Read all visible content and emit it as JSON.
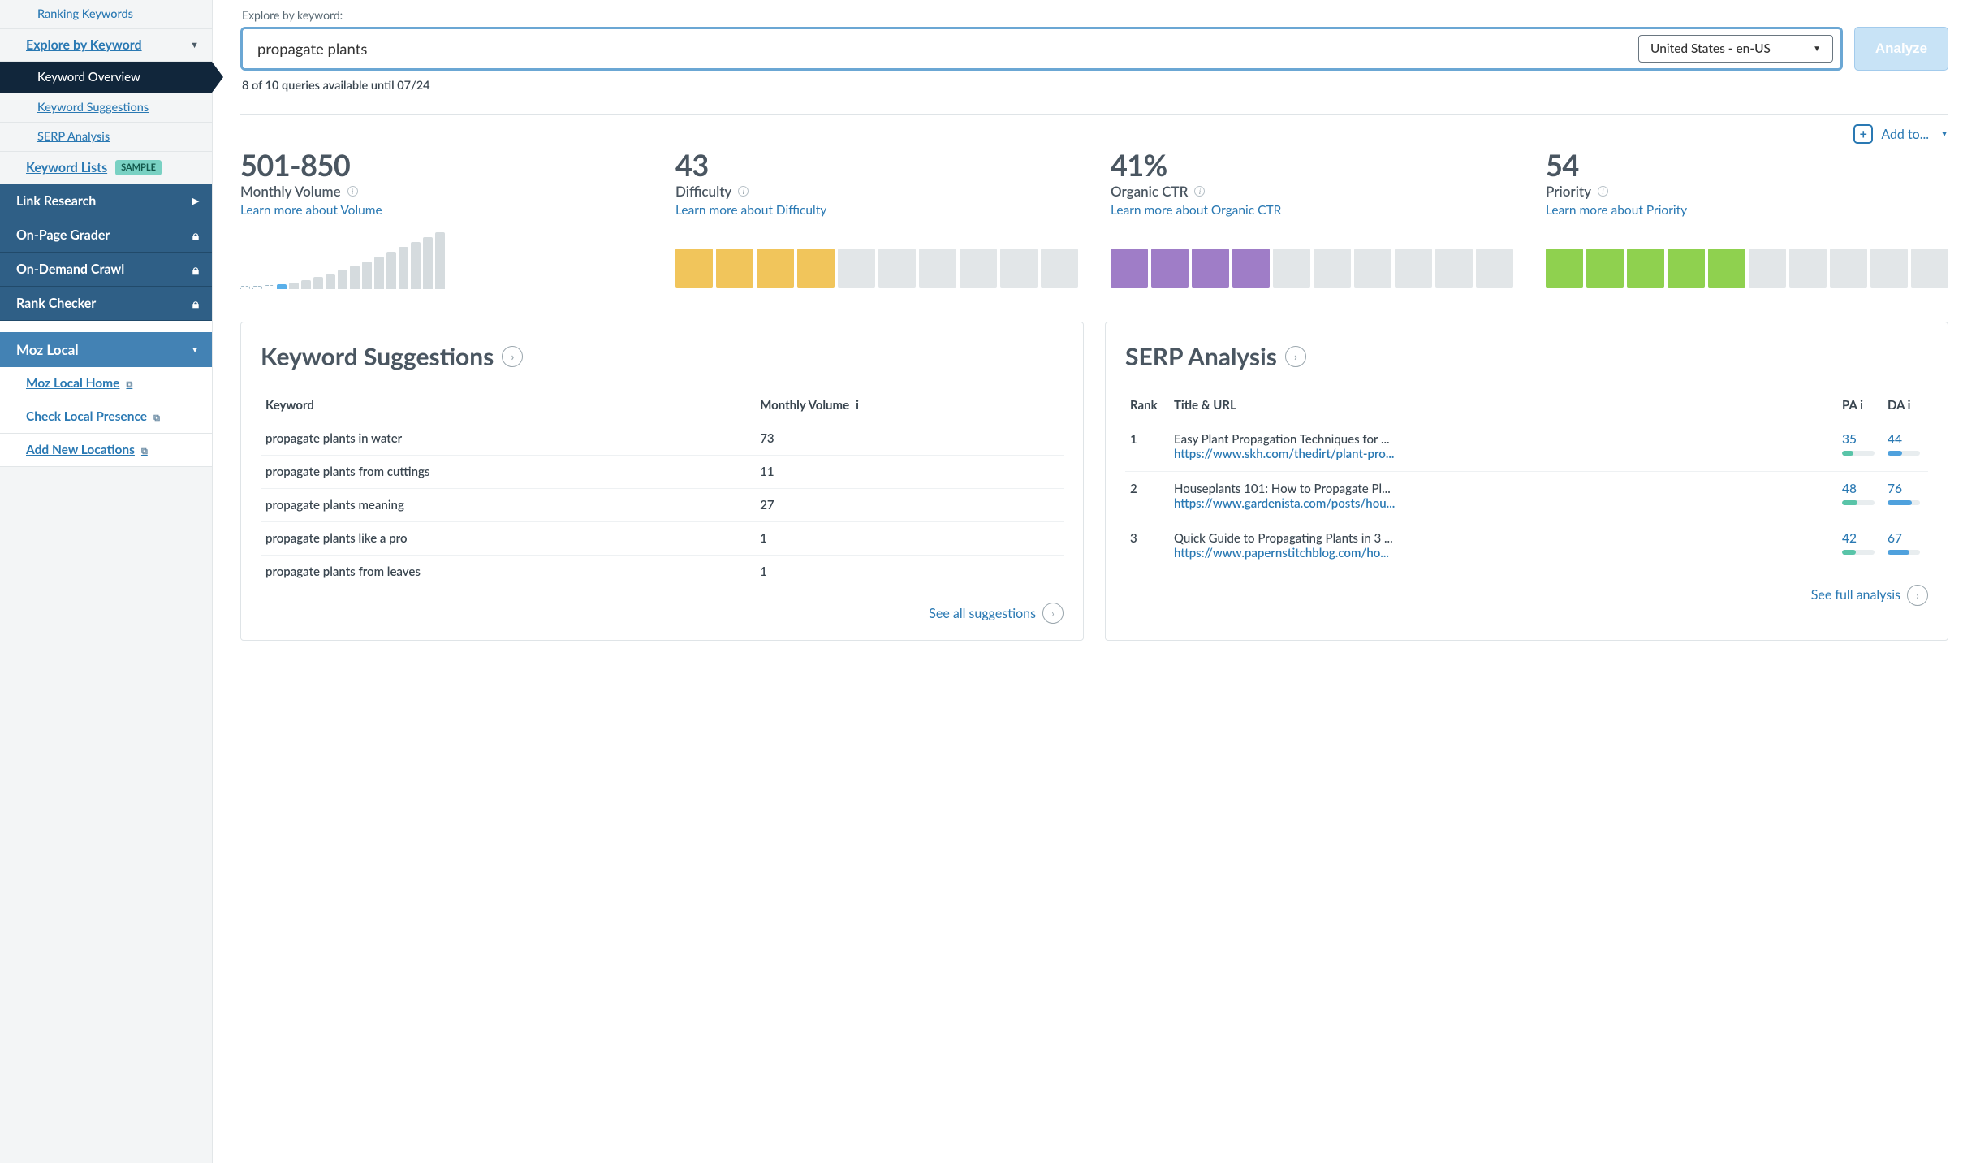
{
  "sidebar": {
    "ranking_keywords": "Ranking Keywords",
    "explore_by_keyword": "Explore by Keyword",
    "keyword_overview": "Keyword Overview",
    "keyword_suggestions": "Keyword Suggestions",
    "serp_analysis": "SERP Analysis",
    "keyword_lists": "Keyword Lists",
    "sample_badge": "SAMPLE",
    "link_research": "Link Research",
    "on_page_grader": "On-Page Grader",
    "on_demand_crawl": "On-Demand Crawl",
    "rank_checker": "Rank Checker",
    "moz_local": "Moz Local",
    "moz_local_home": "Moz Local Home",
    "check_local_presence": "Check Local Presence",
    "add_new_locations": "Add New Locations"
  },
  "search": {
    "label": "Explore by keyword:",
    "value": "propagate plants",
    "locale": "United States - en-US",
    "analyze": "Analyze",
    "quota": "8 of 10 queries available until 07/24"
  },
  "add_to": "Add to...",
  "metrics": {
    "volume": {
      "value": "501-850",
      "title": "Monthly Volume",
      "learn": "Learn more about Volume"
    },
    "difficulty": {
      "value": "43",
      "title": "Difficulty",
      "learn": "Learn more about Difficulty"
    },
    "ctr": {
      "value": "41%",
      "title": "Organic CTR",
      "learn": "Learn more about Organic CTR"
    },
    "priority": {
      "value": "54",
      "title": "Priority",
      "learn": "Learn more about Priority"
    }
  },
  "suggestions": {
    "title": "Keyword Suggestions",
    "col_keyword": "Keyword",
    "col_volume": "Monthly Volume",
    "rows": [
      {
        "kw": "propagate plants in water",
        "vol": "73"
      },
      {
        "kw": "propagate plants from cuttings",
        "vol": "11"
      },
      {
        "kw": "propagate plants meaning",
        "vol": "27"
      },
      {
        "kw": "propagate plants like a pro",
        "vol": "1"
      },
      {
        "kw": "propagate plants from leaves",
        "vol": "1"
      }
    ],
    "see_all": "See all suggestions"
  },
  "serp": {
    "title": "SERP Analysis",
    "col_rank": "Rank",
    "col_title": "Title & URL",
    "col_pa": "PA",
    "col_da": "DA",
    "rows": [
      {
        "rank": "1",
        "title": "Easy Plant Propagation Techniques for ...",
        "url": "https://www.skh.com/thedirt/plant-pro...",
        "pa": "35",
        "da": "44"
      },
      {
        "rank": "2",
        "title": "Houseplants 101: How to Propagate Pl...",
        "url": "https://www.gardenista.com/posts/hou...",
        "pa": "48",
        "da": "76"
      },
      {
        "rank": "3",
        "title": "Quick Guide to Propagating Plants in 3 ...",
        "url": "https://www.papernstitchblog.com/ho...",
        "pa": "42",
        "da": "67"
      }
    ],
    "see_full": "See full analysis"
  },
  "chart_data": {
    "type": "bar",
    "difficulty_filled": 4,
    "ctr_filled": 4,
    "priority_filled": 5,
    "volume_bars": [
      4,
      4,
      5,
      6,
      8,
      11,
      15,
      19,
      24,
      29,
      34,
      40,
      46,
      52,
      58,
      64,
      70
    ]
  }
}
